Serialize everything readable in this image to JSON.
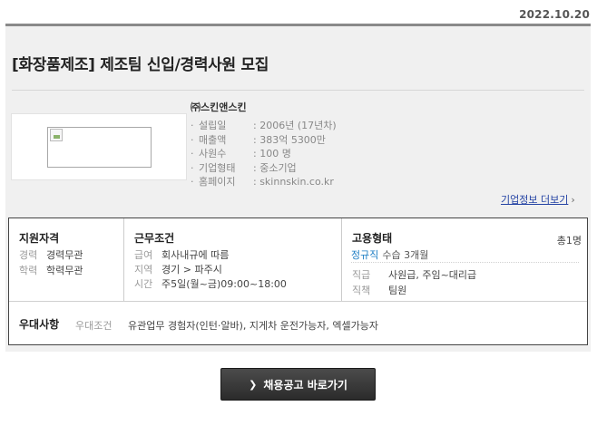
{
  "header": {
    "date": "2022.10.20"
  },
  "posting": {
    "title": "[화장품제조] 제조팀 신입/경력사원 모집",
    "company_name": "㈜스킨앤스킨",
    "company_info": [
      {
        "label": "설립일",
        "value": ": 2006년 (17년차)"
      },
      {
        "label": "매출액",
        "value": ": 383억 5300만"
      },
      {
        "label": "사원수",
        "value": ": 100 명"
      },
      {
        "label": "기업형태",
        "value": ": 중소기업"
      },
      {
        "label": "홈페이지",
        "value": ": skinnskin.co.kr"
      }
    ],
    "company_more_link": "기업정보 더보기",
    "bullet": "·"
  },
  "conditions": {
    "qualification": {
      "heading": "지원자격",
      "rows": [
        {
          "label": "경력",
          "value": "경력무관"
        },
        {
          "label": "학력",
          "value": "학력무관"
        }
      ]
    },
    "work": {
      "heading": "근무조건",
      "rows": [
        {
          "label": "급여",
          "value": "회사내규에 따름"
        },
        {
          "label": "지역",
          "value": "경기 > 파주시"
        },
        {
          "label": "시간",
          "value": "주5일(월~금)09:00~18:00"
        }
      ]
    },
    "employment": {
      "heading": "고용형태",
      "count": "총1명",
      "type": "정규직",
      "probation": "수습 3개월",
      "rows": [
        {
          "label": "직급",
          "value": "사원급, 주임~대리급"
        },
        {
          "label": "직책",
          "value": "팀원"
        }
      ]
    },
    "preference": {
      "heading": "우대사항",
      "label": "우대조건",
      "value": "유관업무 경험자(인턴·알바), 지게차 운전가능자, 엑셀가능자"
    }
  },
  "action": {
    "apply_label": "채용공고 바로가기",
    "icon": "chevron-right-icon"
  },
  "colors": {
    "link": "#2443a4",
    "accent_blue": "#1e7ec4",
    "button_bg": "#333333"
  }
}
